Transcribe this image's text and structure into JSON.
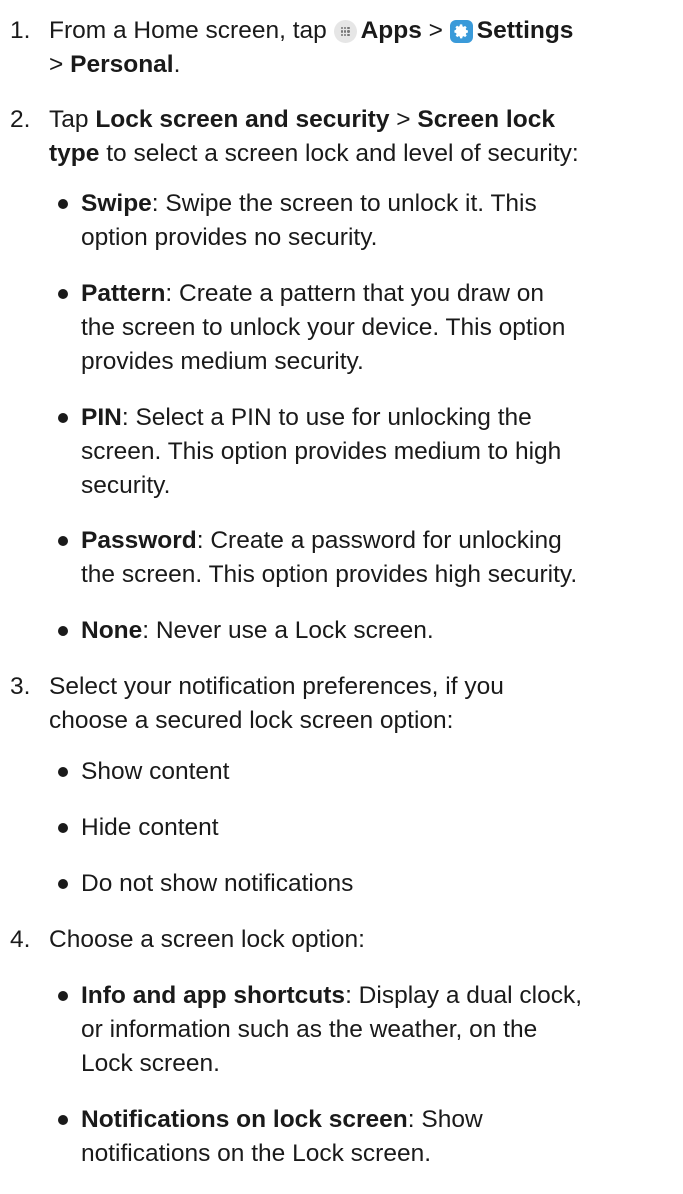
{
  "steps": [
    {
      "number": "1.",
      "pre": "From a Home screen, tap",
      "apps_label": "Apps",
      "sep": ">",
      "settings_label": "Settings",
      "line2_sep": ">",
      "line2_bold": "Personal",
      "line2_end": "."
    },
    {
      "number": "2.",
      "pre": "Tap",
      "b1": "Lock screen and security",
      "sep": ">",
      "b2": "Screen lock",
      "b3": "type",
      "rest": "to select a screen lock and level of security:",
      "bullets": [
        {
          "bold": "Swipe",
          "lines": [
            ": Swipe the screen to unlock it. This",
            "option provides no security."
          ]
        },
        {
          "bold": "Pattern",
          "lines": [
            ": Create a pattern that you draw on",
            "the screen to unlock your device. This option",
            "provides medium security."
          ]
        },
        {
          "bold": "PIN",
          "lines": [
            ": Select a PIN to use for unlocking the",
            "screen. This option provides medium to high",
            "security."
          ]
        },
        {
          "bold": "Password",
          "lines": [
            ": Create a password for unlocking",
            "the screen. This option provides high security."
          ]
        },
        {
          "bold": "None",
          "lines": [
            ": Never use a Lock screen."
          ]
        }
      ]
    },
    {
      "number": "3.",
      "lines": [
        "Select your notification preferences, if you",
        "choose a secured lock screen option:"
      ],
      "bullets": [
        "Show content",
        "Hide content",
        "Do not show notifications"
      ]
    },
    {
      "number": "4.",
      "lines": [
        "Choose a screen lock option:"
      ],
      "bullets": [
        {
          "bold": "Info and app shortcuts",
          "lines": [
            ": Display a dual clock,",
            "or information such as the weather, on the",
            "Lock screen."
          ]
        },
        {
          "bold": "Notifications on lock screen",
          "lines": [
            ": Show",
            "notifications on the Lock screen."
          ]
        }
      ]
    }
  ],
  "icons": {
    "apps": "apps-grid-icon",
    "settings": "gear-icon"
  },
  "colors": {
    "text": "#1a1a1a",
    "settings_icon": "#3a9ad9",
    "apps_icon": "#e6e6e6"
  }
}
